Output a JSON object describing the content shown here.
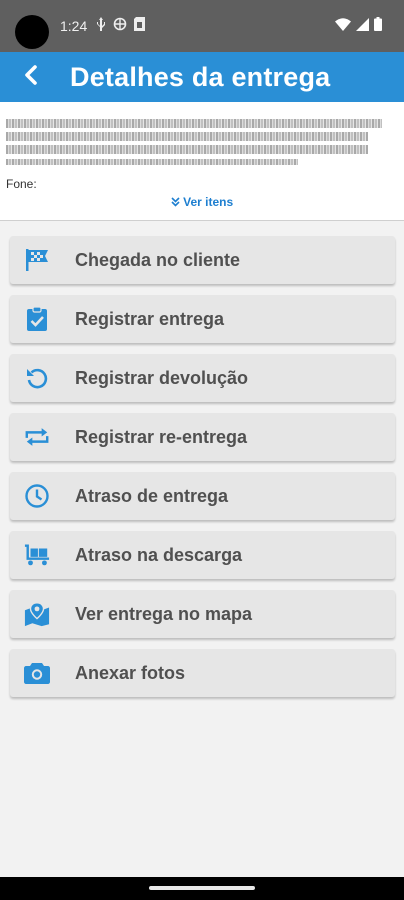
{
  "status_bar": {
    "time": "1:24",
    "icons_left": [
      "usb-icon",
      "vpn-icon",
      "sim-icon"
    ],
    "icons_right": [
      "wifi-icon",
      "signal-icon",
      "battery-icon"
    ]
  },
  "app_bar": {
    "title": "Detalhes da entrega",
    "back_icon": "chevron-left-icon",
    "color": "#2a8fd6"
  },
  "info": {
    "phone_label": "Fone:",
    "view_items_label": "Ver itens",
    "link_color": "#1e7fd0"
  },
  "actions": [
    {
      "label": "Chegada no cliente",
      "icon": "checkered-flag-icon"
    },
    {
      "label": "Registrar entrega",
      "icon": "clipboard-check-icon"
    },
    {
      "label": "Registrar devolução",
      "icon": "undo-icon"
    },
    {
      "label": "Registrar re-entrega",
      "icon": "repeat-icon"
    },
    {
      "label": "Atraso de entrega",
      "icon": "clock-icon"
    },
    {
      "label": "Atraso na descarga",
      "icon": "pallet-truck-icon"
    },
    {
      "label": "Ver entrega no mapa",
      "icon": "map-marker-icon"
    },
    {
      "label": "Anexar fotos",
      "icon": "camera-icon"
    }
  ],
  "colors": {
    "icon_blue": "#2a8fd6",
    "button_bg": "#e6e6e6",
    "button_text": "#505050"
  }
}
